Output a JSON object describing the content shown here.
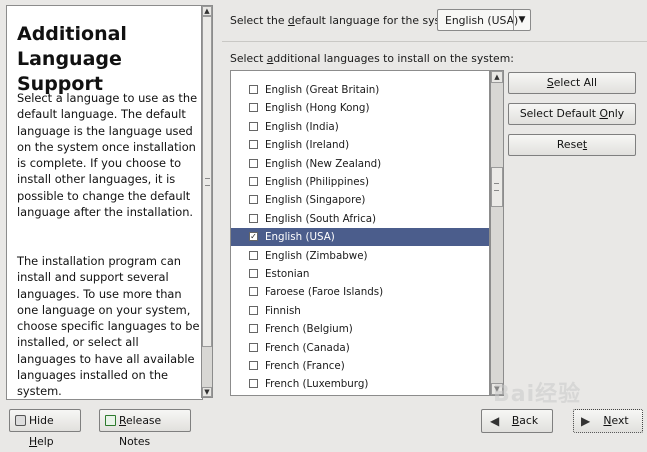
{
  "help": {
    "title": "Additional Language Support",
    "paragraph1": "Select a language to use as the default language. The default language is the language used on the system once installation is complete. If you choose to install other languages, it is possible to change the default language after the installation.",
    "paragraph2": "The installation program can install and support several languages. To use more than one language on your system, choose specific languages to be installed, or select all languages to have all available languages installed on the system."
  },
  "default_language": {
    "label_pre": "Select the ",
    "label_key": "d",
    "label_post": "efault language for the system:",
    "selected": "English (USA)"
  },
  "additional": {
    "label_pre": "Select ",
    "label_key": "a",
    "label_post": "dditional languages to install on the system:"
  },
  "languages": [
    {
      "label": "English (Great Britain)",
      "checked": false
    },
    {
      "label": "English (Hong Kong)",
      "checked": false
    },
    {
      "label": "English (India)",
      "checked": false
    },
    {
      "label": "English (Ireland)",
      "checked": false
    },
    {
      "label": "English (New Zealand)",
      "checked": false
    },
    {
      "label": "English (Philippines)",
      "checked": false
    },
    {
      "label": "English (Singapore)",
      "checked": false
    },
    {
      "label": "English (South Africa)",
      "checked": false
    },
    {
      "label": "English (USA)",
      "checked": true,
      "selected": true
    },
    {
      "label": "English (Zimbabwe)",
      "checked": false
    },
    {
      "label": "Estonian",
      "checked": false
    },
    {
      "label": "Faroese (Faroe Islands)",
      "checked": false
    },
    {
      "label": "Finnish",
      "checked": false
    },
    {
      "label": "French (Belgium)",
      "checked": false
    },
    {
      "label": "French (Canada)",
      "checked": false
    },
    {
      "label": "French (France)",
      "checked": false
    },
    {
      "label": "French (Luxemburg)",
      "checked": false
    }
  ],
  "buttons": {
    "select_all_key": "S",
    "select_all_rest": "elect All",
    "select_default_pre": "Select Default ",
    "select_default_key": "O",
    "select_default_rest": "nly",
    "reset_pre": "Rese",
    "reset_key": "t",
    "hide_help_pre": "Hide ",
    "hide_help_key": "H",
    "hide_help_rest": "elp",
    "release_notes_key": "R",
    "release_notes_rest": "elease Notes",
    "back_key": "B",
    "back_rest": "ack",
    "next_key": "N",
    "next_rest": "ext"
  },
  "icons": {
    "help": "help-book-icon",
    "release_notes": "release-notes-icon",
    "back": "back-arrow-icon",
    "next": "next-arrow-icon"
  },
  "colors": {
    "selection": "#4b5d8c",
    "background": "#e9e8e6"
  },
  "watermark": "Bai经验"
}
